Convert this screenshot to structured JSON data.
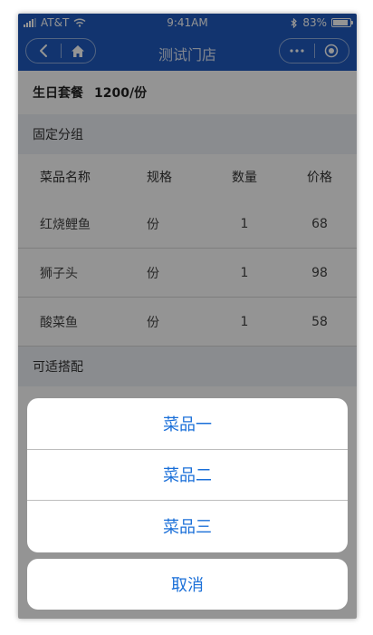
{
  "status_bar": {
    "carrier": "AT&T",
    "time": "9:41AM",
    "battery": "83%"
  },
  "nav": {
    "title": "测试门店"
  },
  "package": {
    "name": "生日套餐",
    "price": "1200/份"
  },
  "fixed_group": {
    "title": "固定分组",
    "headers": [
      "菜品名称",
      "规格",
      "数量",
      "价格"
    ],
    "rows": [
      [
        "红烧鲤鱼",
        "份",
        "1",
        "68"
      ],
      [
        "狮子头",
        "份",
        "1",
        "98"
      ],
      [
        "酸菜鱼",
        "份",
        "1",
        "58"
      ]
    ]
  },
  "optional_group": {
    "title": "可适搭配"
  },
  "action_sheet": {
    "items": [
      "菜品一",
      "菜品二",
      "菜品三"
    ],
    "cancel": "取消"
  },
  "colors": {
    "nav_bg": "#1f5bbf",
    "action_text": "#1a6fd8"
  }
}
